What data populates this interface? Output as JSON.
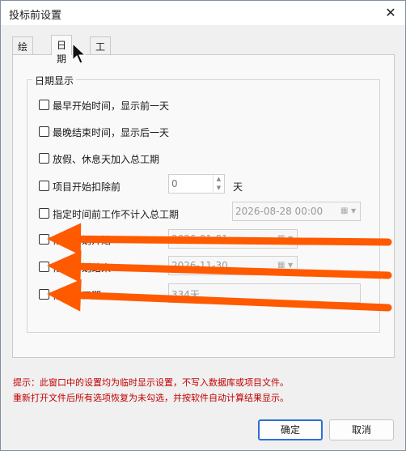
{
  "window": {
    "title": "投标前设置",
    "close_glyph": "✕"
  },
  "tabs": [
    {
      "label": "绘图"
    },
    {
      "label": "日期"
    },
    {
      "label": "工程标尺"
    }
  ],
  "group": {
    "title": "日期显示"
  },
  "options": [
    {
      "label": "最早开始时间，显示前一天",
      "checked": false
    },
    {
      "label": "最晚结束时间，显示后一天",
      "checked": false
    },
    {
      "label": "放假、休息天加入总工期",
      "checked": false
    },
    {
      "label": "项目开始扣除前",
      "checked": false,
      "value": "0",
      "unit": "天"
    },
    {
      "label": "指定时间前工作不计入总工期",
      "checked": false,
      "value": "2026-08-28 00:00"
    },
    {
      "label": "修改计划开始",
      "checked": false,
      "value": "2026-01-01"
    },
    {
      "label": "修改计划结束",
      "checked": false,
      "value": "2026-11-30"
    },
    {
      "label": "修改总工期",
      "checked": false,
      "value": "334天"
    }
  ],
  "tips": [
    "提示：此窗口中的设置均为临时显示设置，不写入数据库或项目文件。",
    "重新打开文件后所有选项恢复为未勾选，并按软件自动计算结果显示。"
  ],
  "buttons": {
    "ok": "确定",
    "cancel": "取消"
  },
  "spinner": {
    "up_glyph": "▲",
    "down_glyph": "▼"
  },
  "picker": {
    "calendar_glyph": "▦",
    "dropdown_glyph": "▼"
  },
  "annotation": {
    "arrow_color": "#ff5a00",
    "arrow_count": 3
  }
}
